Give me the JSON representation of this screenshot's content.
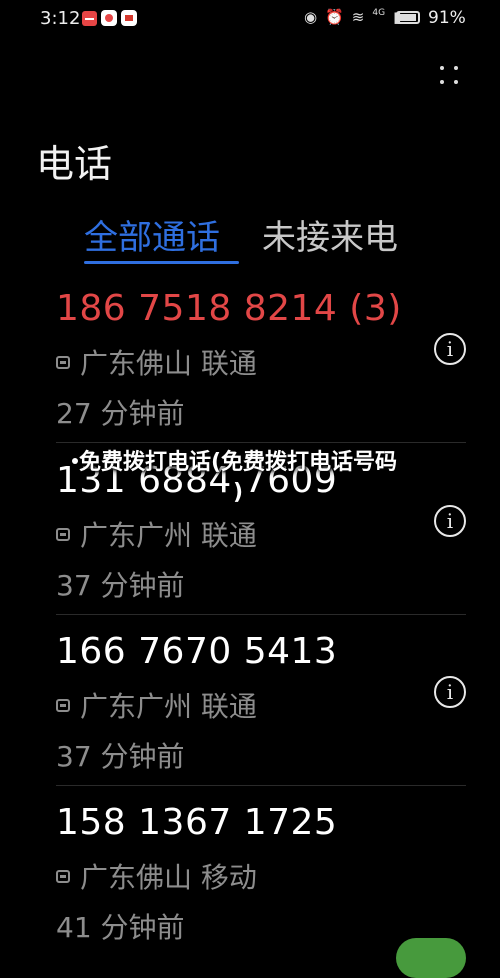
{
  "status_bar": {
    "time": "3:12",
    "network": "4G",
    "battery": "91%"
  },
  "header": {
    "title": "电话"
  },
  "tabs": [
    {
      "label": "全部通话",
      "active": true
    },
    {
      "label": "未接来电",
      "active": false
    }
  ],
  "calls": [
    {
      "number": "186 7518 8214 (3)",
      "missed": true,
      "location": "广东佛山 联通",
      "time_ago": "27 分钟前"
    },
    {
      "number": "131 6884 7609",
      "missed": false,
      "location": "广东广州 联通",
      "time_ago": "37 分钟前"
    },
    {
      "number": "166 7670 5413",
      "missed": false,
      "location": "广东广州 联通",
      "time_ago": "37 分钟前"
    },
    {
      "number": "158 1367 1725",
      "missed": false,
      "location": "广东佛山 移动",
      "time_ago": "41 分钟前"
    }
  ],
  "overlay": {
    "line1": "免费拨打电话(免费拨打电话号码",
    "line2": ")"
  },
  "colors": {
    "accent": "#2f6fe0",
    "missed": "#e24747"
  }
}
